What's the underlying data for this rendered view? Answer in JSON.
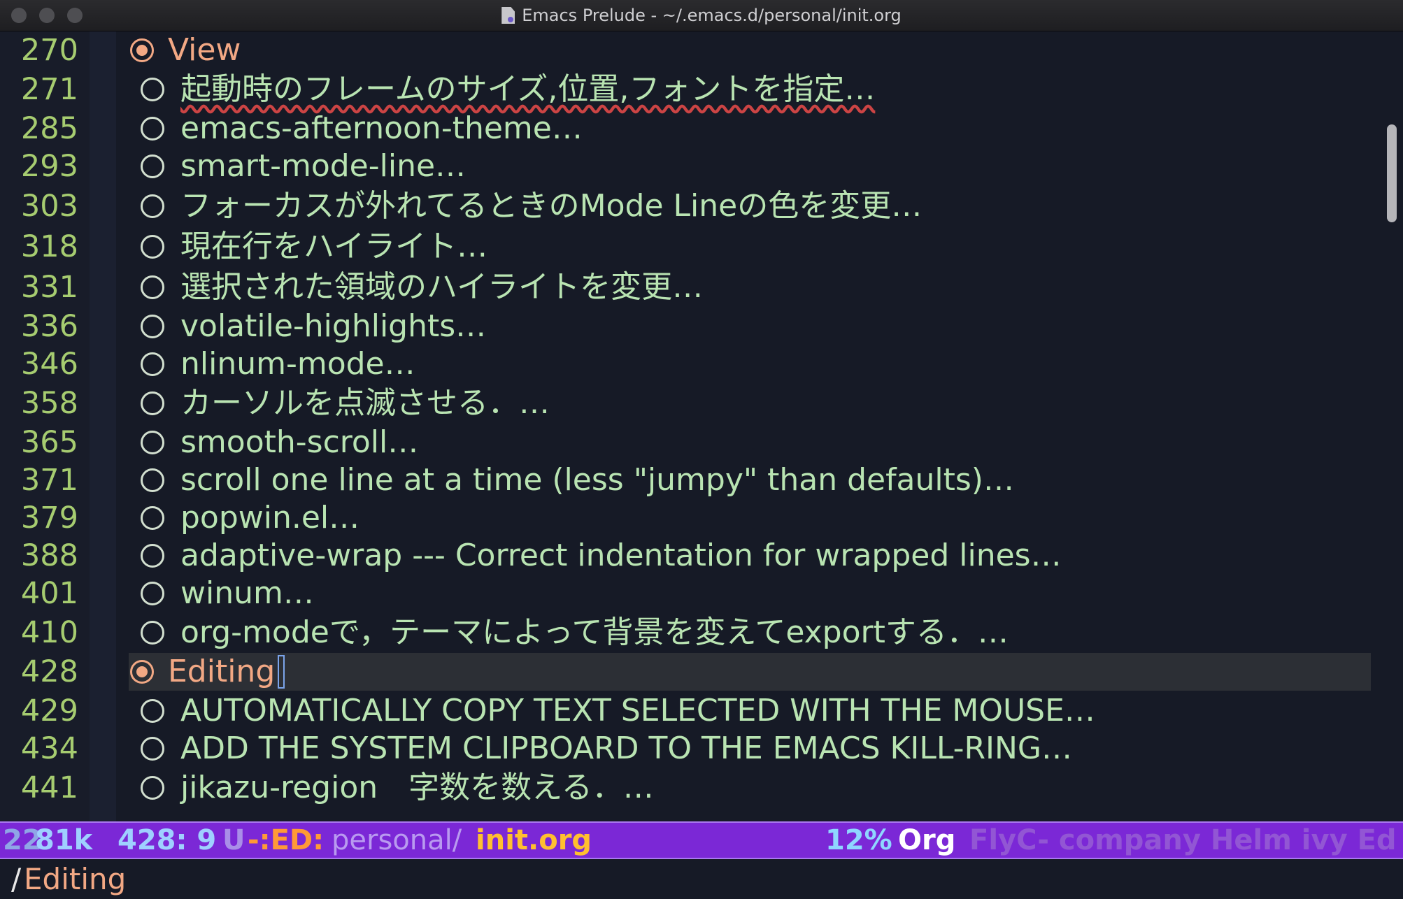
{
  "window": {
    "title": "Emacs Prelude - ~/.emacs.d/personal/init.org"
  },
  "lines": [
    {
      "num": "270",
      "text": "View",
      "heading": true
    },
    {
      "num": "271",
      "text": "起動時のフレームのサイズ,位置,フォントを指定…"
    },
    {
      "num": "285",
      "text": "emacs-afternoon-theme…"
    },
    {
      "num": "293",
      "text": "smart-mode-line…"
    },
    {
      "num": "303",
      "text": "フォーカスが外れてるときのMode Lineの色を変更…"
    },
    {
      "num": "318",
      "text": "現在行をハイライト…"
    },
    {
      "num": "331",
      "text": "選択された領域のハイライトを変更…"
    },
    {
      "num": "336",
      "text": "volatile-highlights…"
    },
    {
      "num": "346",
      "text": "nlinum-mode…"
    },
    {
      "num": "358",
      "text": "カーソルを点滅させる．…"
    },
    {
      "num": "365",
      "text": "smooth-scroll…"
    },
    {
      "num": "371",
      "text": "scroll one line at a time (less \"jumpy\" than defaults)…"
    },
    {
      "num": "379",
      "text": "popwin.el…"
    },
    {
      "num": "388",
      "text": "adaptive-wrap --- Correct indentation for wrapped lines…"
    },
    {
      "num": "401",
      "text": "winum…"
    },
    {
      "num": "410",
      "text": "org-modeで，テーマによって背景を変えてexportする．…"
    },
    {
      "num": "428",
      "text": "Editing",
      "heading": true,
      "current": true
    },
    {
      "num": "429",
      "text": "AUTOMATICALLY COPY TEXT SELECTED WITH THE MOUSE…"
    },
    {
      "num": "434",
      "text": "ADD THE SYSTEM CLIPBOARD TO THE EMACS KILL-RING…"
    },
    {
      "num": "441",
      "text": "jikazu-region　字数を数える．…"
    }
  ],
  "modeline": {
    "size_prefix": "22",
    "size": "81k",
    "position": "428: 9",
    "encoding": "U",
    "flags": "-:ED:",
    "dir": "personal/",
    "file": "init.org",
    "percent": "12%",
    "mode": "Org",
    "minor_modes": "FlyC- company Helm ivy Ed"
  },
  "minibuffer": {
    "slash": "/",
    "text": "Editing"
  },
  "colors": {
    "background": "#161a26",
    "line_number": "#a6cc70",
    "text": "#b9e4b2",
    "heading": "#f2a884",
    "modeline_bg": "#7b28d6"
  }
}
